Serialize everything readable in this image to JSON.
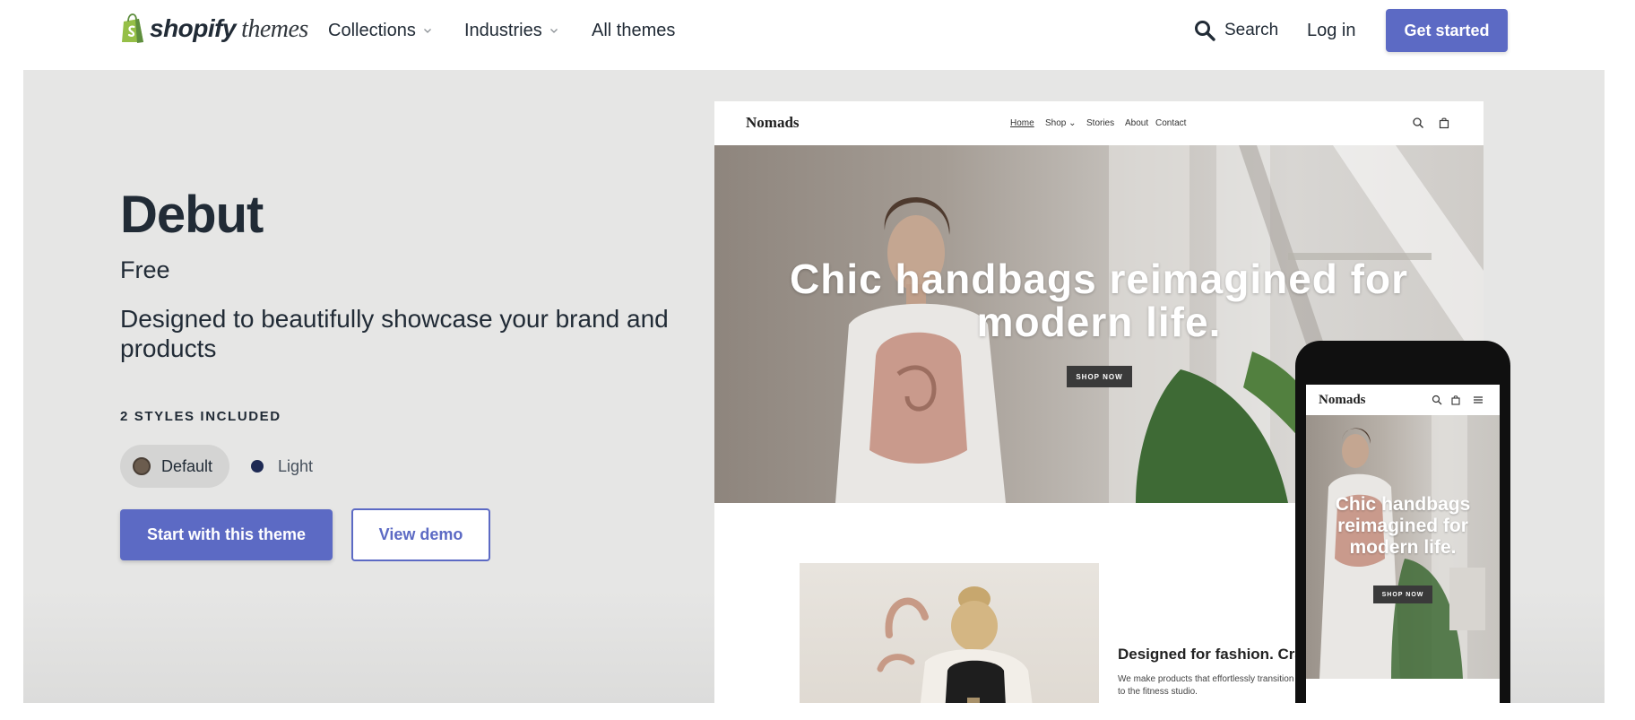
{
  "nav": {
    "logo_word_1": "shopify",
    "logo_word_2": "themes",
    "collections": "Collections",
    "industries": "Industries",
    "all_themes": "All themes",
    "search": "Search",
    "login": "Log in",
    "get_started": "Get started"
  },
  "theme": {
    "name": "Debut",
    "price": "Free",
    "tagline": "Designed to beautifully showcase your brand and products",
    "styles_label": "2 STYLES INCLUDED",
    "styles": [
      {
        "label": "Default",
        "color": "#6b5c4e",
        "selected": true
      },
      {
        "label": "Light",
        "color": "#1e2a54",
        "selected": false
      }
    ],
    "start_button": "Start with this theme",
    "demo_button": "View demo"
  },
  "preview_desktop": {
    "brand": "Nomads",
    "nav": [
      "Home",
      "Shop",
      "Stories",
      "About",
      "Contact"
    ],
    "hero_heading": "Chic handbags reimagined for modern life.",
    "hero_button": "SHOP NOW",
    "feature_title": "Designed for fashion. Crafted for",
    "feature_text": "We make products that effortlessly transition From the board room to the fitness studio."
  },
  "preview_mobile": {
    "brand": "Nomads",
    "hero_heading": "Chic handbags reimagined for modern life.",
    "hero_button": "SHOP NOW"
  },
  "colors": {
    "accent": "#5c6ac4",
    "text": "#212b36",
    "hero_bg": "#e6e6e5",
    "logo_green": "#95bf47"
  }
}
